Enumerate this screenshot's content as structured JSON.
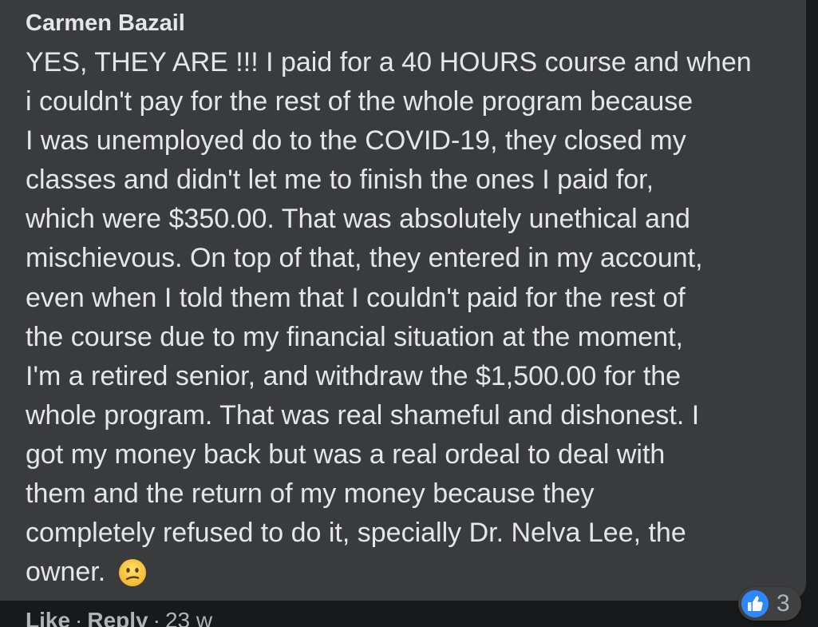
{
  "comment": {
    "author": "Carmen Bazail",
    "lines": [
      "YES, THEY ARE !!! I paid for a 40 HOURS course and when",
      "i couldn't pay for the rest of the whole program because",
      "I was unemployed do to the COVID-19, they closed my",
      "classes and didn't let me to finish the ones I paid for,",
      "which were $350.00. That was absolutely unethical and",
      "mischievous. On top of that, they entered in my account,",
      "even when I told them that I couldn't paid for the rest of",
      "the course due to my financial situation at the moment,",
      "I'm a retired senior, and withdraw the $1,500.00 for the",
      "whole program. That was real shameful and dishonest. I",
      "got my money back but was a real ordeal to deal with",
      "them and the return of my money because they",
      "completely refused to do it, specially Dr. Nelva Lee, the",
      "owner."
    ],
    "emoji": "confused-face-emoji"
  },
  "reactions": {
    "icon": "like-icon",
    "count": "3",
    "badge_color": "#2d88ff"
  },
  "actions": {
    "like_label": "Like",
    "separator": "·",
    "reply_label": "Reply",
    "timestamp": "23 w"
  },
  "colors": {
    "bubble": "#3a3b3c",
    "background": "#18191a",
    "text": "#e4e6eb",
    "secondary_text": "#b0b3b8"
  }
}
